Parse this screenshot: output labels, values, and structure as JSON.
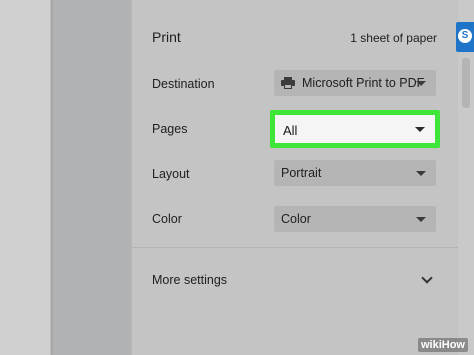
{
  "print": {
    "title": "Print",
    "sheets": "1 sheet of paper"
  },
  "settings": {
    "destination": {
      "label": "Destination",
      "value": "Microsoft Print to PDF",
      "icon": "printer-icon"
    },
    "pages": {
      "label": "Pages",
      "value": "All",
      "highlight_color": "#3fe63a"
    },
    "layout": {
      "label": "Layout",
      "value": "Portrait"
    },
    "color": {
      "label": "Color",
      "value": "Color"
    },
    "more_settings": {
      "label": "More settings",
      "icon": "chevron-down-icon"
    }
  },
  "side": {
    "skype_icon_letter": "S",
    "skype_color": "#1e74c9"
  },
  "watermark": {
    "text": "wikiHow"
  }
}
